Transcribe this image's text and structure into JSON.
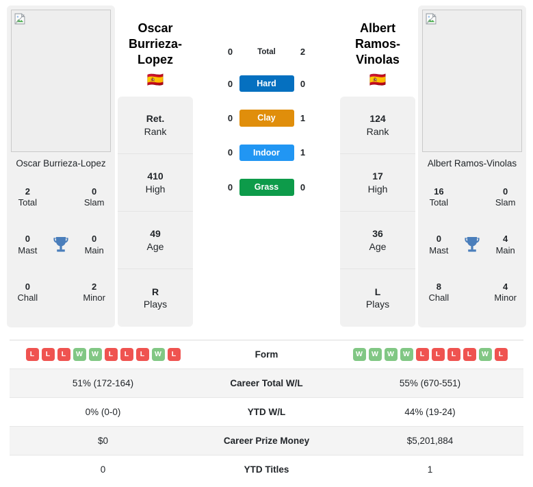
{
  "players": {
    "left": {
      "name": "Oscar Burrieza-Lopez",
      "name_display": "Oscar Burrieza-Lopez",
      "photo_caption": "Oscar Burrieza-Lopez",
      "flag": "🇪🇸",
      "flag_name": "spain-flag",
      "titles": {
        "total_value": "2",
        "total_label": "Total",
        "slam_value": "0",
        "slam_label": "Slam",
        "mast_value": "0",
        "mast_label": "Mast",
        "main_value": "0",
        "main_label": "Main",
        "chall_value": "0",
        "chall_label": "Chall",
        "minor_value": "2",
        "minor_label": "Minor"
      },
      "stats": [
        {
          "value": "Ret.",
          "label": "Rank"
        },
        {
          "value": "410",
          "label": "High"
        },
        {
          "value": "49",
          "label": "Age"
        },
        {
          "value": "R",
          "label": "Plays"
        }
      ],
      "form": [
        "L",
        "L",
        "L",
        "W",
        "W",
        "L",
        "L",
        "L",
        "W",
        "L"
      ],
      "career_total_wl": "51% (172-164)",
      "ytd_wl": "0% (0-0)",
      "career_prize_money": "$0",
      "ytd_titles": "0"
    },
    "right": {
      "name": "Albert Ramos-Vinolas",
      "name_display": "Albert Ramos-Vinolas",
      "photo_caption": "Albert Ramos-Vinolas",
      "flag": "🇪🇸",
      "flag_name": "spain-flag",
      "titles": {
        "total_value": "16",
        "total_label": "Total",
        "slam_value": "0",
        "slam_label": "Slam",
        "mast_value": "0",
        "mast_label": "Mast",
        "main_value": "4",
        "main_label": "Main",
        "chall_value": "8",
        "chall_label": "Chall",
        "minor_value": "4",
        "minor_label": "Minor"
      },
      "stats": [
        {
          "value": "124",
          "label": "Rank"
        },
        {
          "value": "17",
          "label": "High"
        },
        {
          "value": "36",
          "label": "Age"
        },
        {
          "value": "L",
          "label": "Plays"
        }
      ],
      "form": [
        "W",
        "W",
        "W",
        "W",
        "L",
        "L",
        "L",
        "L",
        "W",
        "L"
      ],
      "career_total_wl": "55% (670-551)",
      "ytd_wl": "44% (19-24)",
      "career_prize_money": "$5,201,884",
      "ytd_titles": "1"
    }
  },
  "h2h": {
    "rows": [
      {
        "left": "0",
        "label": "Total",
        "right": "2",
        "type": "plain",
        "color": ""
      },
      {
        "left": "0",
        "label": "Hard",
        "right": "0",
        "type": "badge",
        "color": "#0570c0"
      },
      {
        "left": "0",
        "label": "Clay",
        "right": "1",
        "type": "badge",
        "color": "#e08e0b"
      },
      {
        "left": "0",
        "label": "Indoor",
        "right": "1",
        "type": "badge",
        "color": "#2196f3"
      },
      {
        "left": "0",
        "label": "Grass",
        "right": "0",
        "type": "badge",
        "color": "#0d9b4a"
      }
    ]
  },
  "comparison_table": {
    "rows": [
      {
        "label": "Form",
        "type": "form",
        "left": "",
        "right": ""
      },
      {
        "label": "Career Total W/L",
        "type": "text",
        "left": "51% (172-164)",
        "right": "55% (670-551)"
      },
      {
        "label": "YTD W/L",
        "type": "text",
        "left": "0% (0-0)",
        "right": "44% (19-24)"
      },
      {
        "label": "Career Prize Money",
        "type": "text",
        "left": "$0",
        "right": "$5,201,884"
      },
      {
        "label": "YTD Titles",
        "type": "text",
        "left": "0",
        "right": "1"
      }
    ]
  },
  "icons": {
    "trophy": "trophy-icon",
    "broken_image": "broken-image-icon"
  },
  "colors": {
    "hard": "#0570c0",
    "clay": "#e08e0b",
    "indoor": "#2196f3",
    "grass": "#0d9b4a",
    "win_badge": "#81c784",
    "loss_badge": "#ef5350",
    "card_bg": "#f1f1f1",
    "row_shade": "#f4f4f4"
  }
}
